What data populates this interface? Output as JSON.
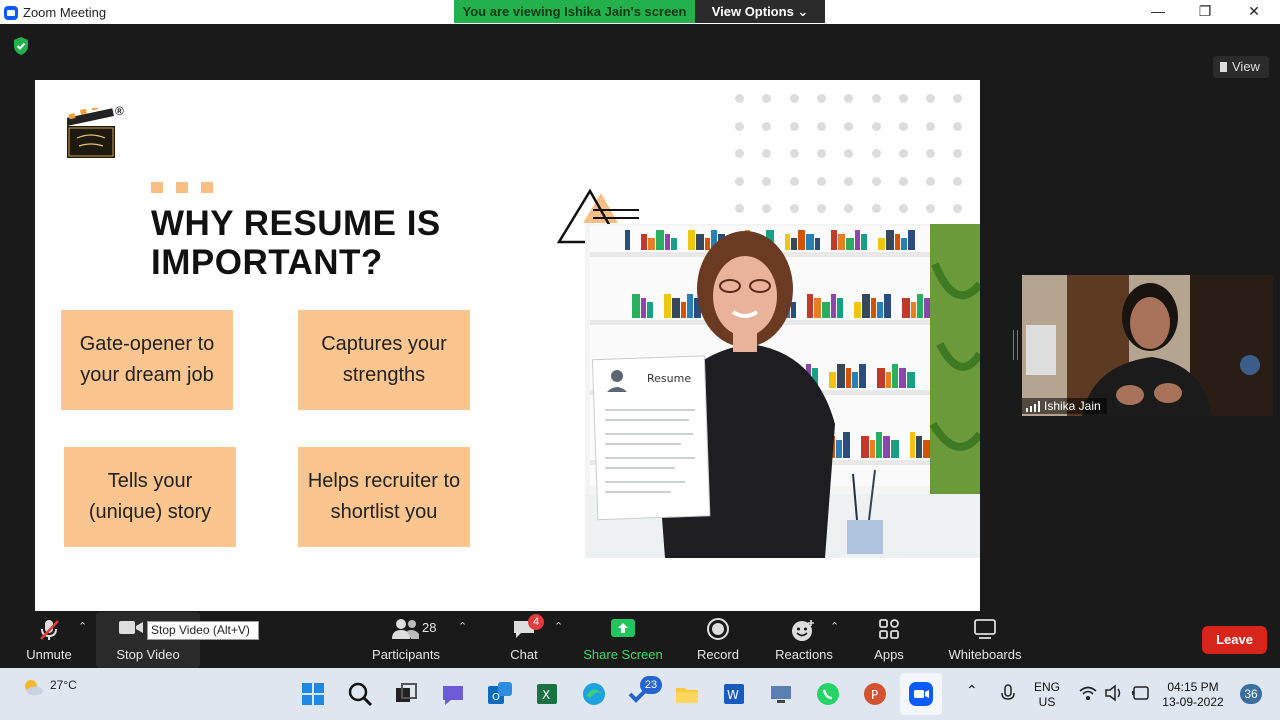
{
  "window": {
    "title": "Zoom Meeting",
    "minimize": "—",
    "maximize": "❐",
    "close": "✕"
  },
  "banner": {
    "text": "You are viewing Ishika Jain's screen",
    "view_options": "View Options ⌄"
  },
  "view_button": "View",
  "slide": {
    "title": "WHY RESUME IS IMPORTANT?",
    "reg_mark": "®",
    "cards": [
      "Gate-opener to your dream job",
      "Captures your strengths",
      "Tells your (unique) story",
      "Helps recruiter to shortlist you"
    ],
    "resume_label": "Resume",
    "accent_color": "#fbc590"
  },
  "participant": {
    "name": "Ishika Jain"
  },
  "toolbar": {
    "unmute": "Unmute",
    "stop_video": "Stop Video",
    "stop_video_tooltip": "Stop Video (Alt+V)",
    "participants": "Participants",
    "participants_count": "28",
    "chat": "Chat",
    "chat_badge": "4",
    "share_screen": "Share Screen",
    "record": "Record",
    "reactions": "Reactions",
    "apps": "Apps",
    "whiteboards": "Whiteboards",
    "leave": "Leave",
    "share_color": "#22c55e",
    "leave_color": "#d7251c"
  },
  "taskbar": {
    "weather": "27°C",
    "lang_top": "ENG",
    "lang_bottom": "US",
    "time": "04:15 PM",
    "date": "13-09-2022",
    "notification_count": "36",
    "todo_badge": "23"
  }
}
